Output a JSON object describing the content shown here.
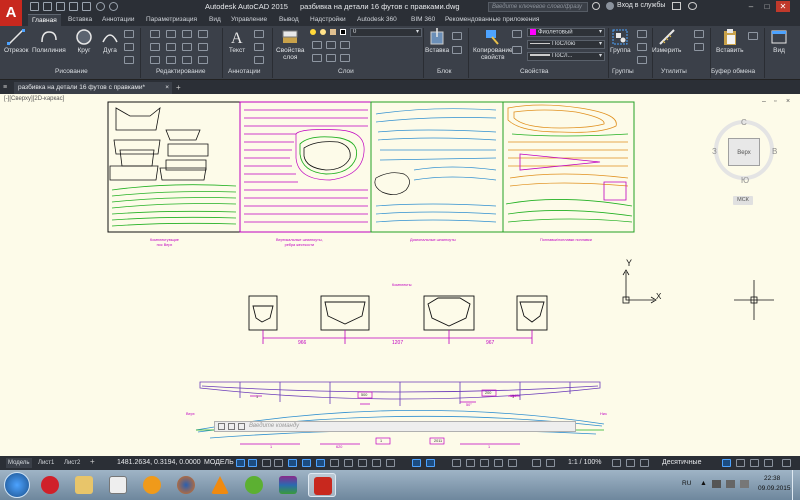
{
  "app": {
    "window_title": "Autodesk AutoCAD 2015",
    "drawing_title": "разбивка на детали 16 футов с правками.dwg",
    "search_placeholder": "Введите ключевое слово/фразу",
    "sign_in": "Вход в службы"
  },
  "tabs": [
    "Главная",
    "Вставка",
    "Аннотации",
    "Параметризация",
    "Вид",
    "Управление",
    "Вывод",
    "Надстройки",
    "Autodesk 360",
    "BIM 360",
    "Рекомендованные приложения"
  ],
  "ribbon": {
    "draw": {
      "line": "Отрезок",
      "polyline": "Полилиния",
      "circle": "Круг",
      "arc": "Дуга",
      "panel": "Рисование"
    },
    "modify": {
      "panel": "Редактирование"
    },
    "annotation": {
      "text": "Текст",
      "panel": "Аннотации"
    },
    "layers": {
      "properties": "Свойства\nслоя",
      "properties_l1": "Свойства",
      "properties_l2": "слоя",
      "current_layer": "0",
      "panel": "Слои"
    },
    "block": {
      "insert": "Вставка",
      "panel": "Блок"
    },
    "properties": {
      "match": "Копирование\nсвойств",
      "match_l1": "Копирование",
      "match_l2": "свойств",
      "color": "Фиолетовый",
      "linetype": "ПоСлою",
      "lineweight": "ПоСл...",
      "panel": "Свойства"
    },
    "groups": {
      "group": "Группа",
      "panel": "Группы"
    },
    "utilities": {
      "measure": "Измерить",
      "panel": "Утилиты"
    },
    "clipboard": {
      "paste": "Вставить",
      "panel": "Буфер обмена"
    },
    "view": {
      "view": "Вид"
    }
  },
  "file_tab": "разбивка на детали 16 футов с правками*",
  "drawing": {
    "sheet_labels": [
      "Комплектующие\nнос Верх",
      "Вертикальные шпангоуты,\nребра жесткости",
      "Диагональные шпангоуты",
      "Поплавки/поплавки поплавки"
    ],
    "section_title": "Комплекты",
    "dims": [
      "966",
      "1207",
      "967"
    ],
    "profile_labels": {
      "left": "Верх",
      "right": "Низ"
    },
    "profile_dims": [
      "1",
      "1",
      "500",
      "200",
      "50°",
      "150°"
    ],
    "bottom_dims": [
      "1",
      "620",
      "1",
      "2011",
      "1"
    ],
    "axis_y": "Y",
    "axis_x": "X"
  },
  "viewcube": {
    "north": "С",
    "south": "Ю",
    "west": "З",
    "east": "В",
    "face": "Верх",
    "ucs": "МСК"
  },
  "command_line_placeholder": "Введите команду",
  "status": {
    "coords": "1481.2634, 0.3194, 0.0000",
    "space": "МОДЕЛЬ",
    "scale": "1:1 / 100%",
    "units": "Десятичные",
    "layout_tabs": [
      "Модель",
      "Лист1",
      "Лист2"
    ]
  },
  "taskbar": {
    "lang": "RU",
    "time": "22:38",
    "date": "09.09.2015"
  },
  "colors": {
    "background": "#fdfbe9",
    "magenta": "#c000c0",
    "green": "#22b022",
    "blue": "#2f8fd0",
    "orange": "#e0901e",
    "accent": "#c8281e"
  }
}
